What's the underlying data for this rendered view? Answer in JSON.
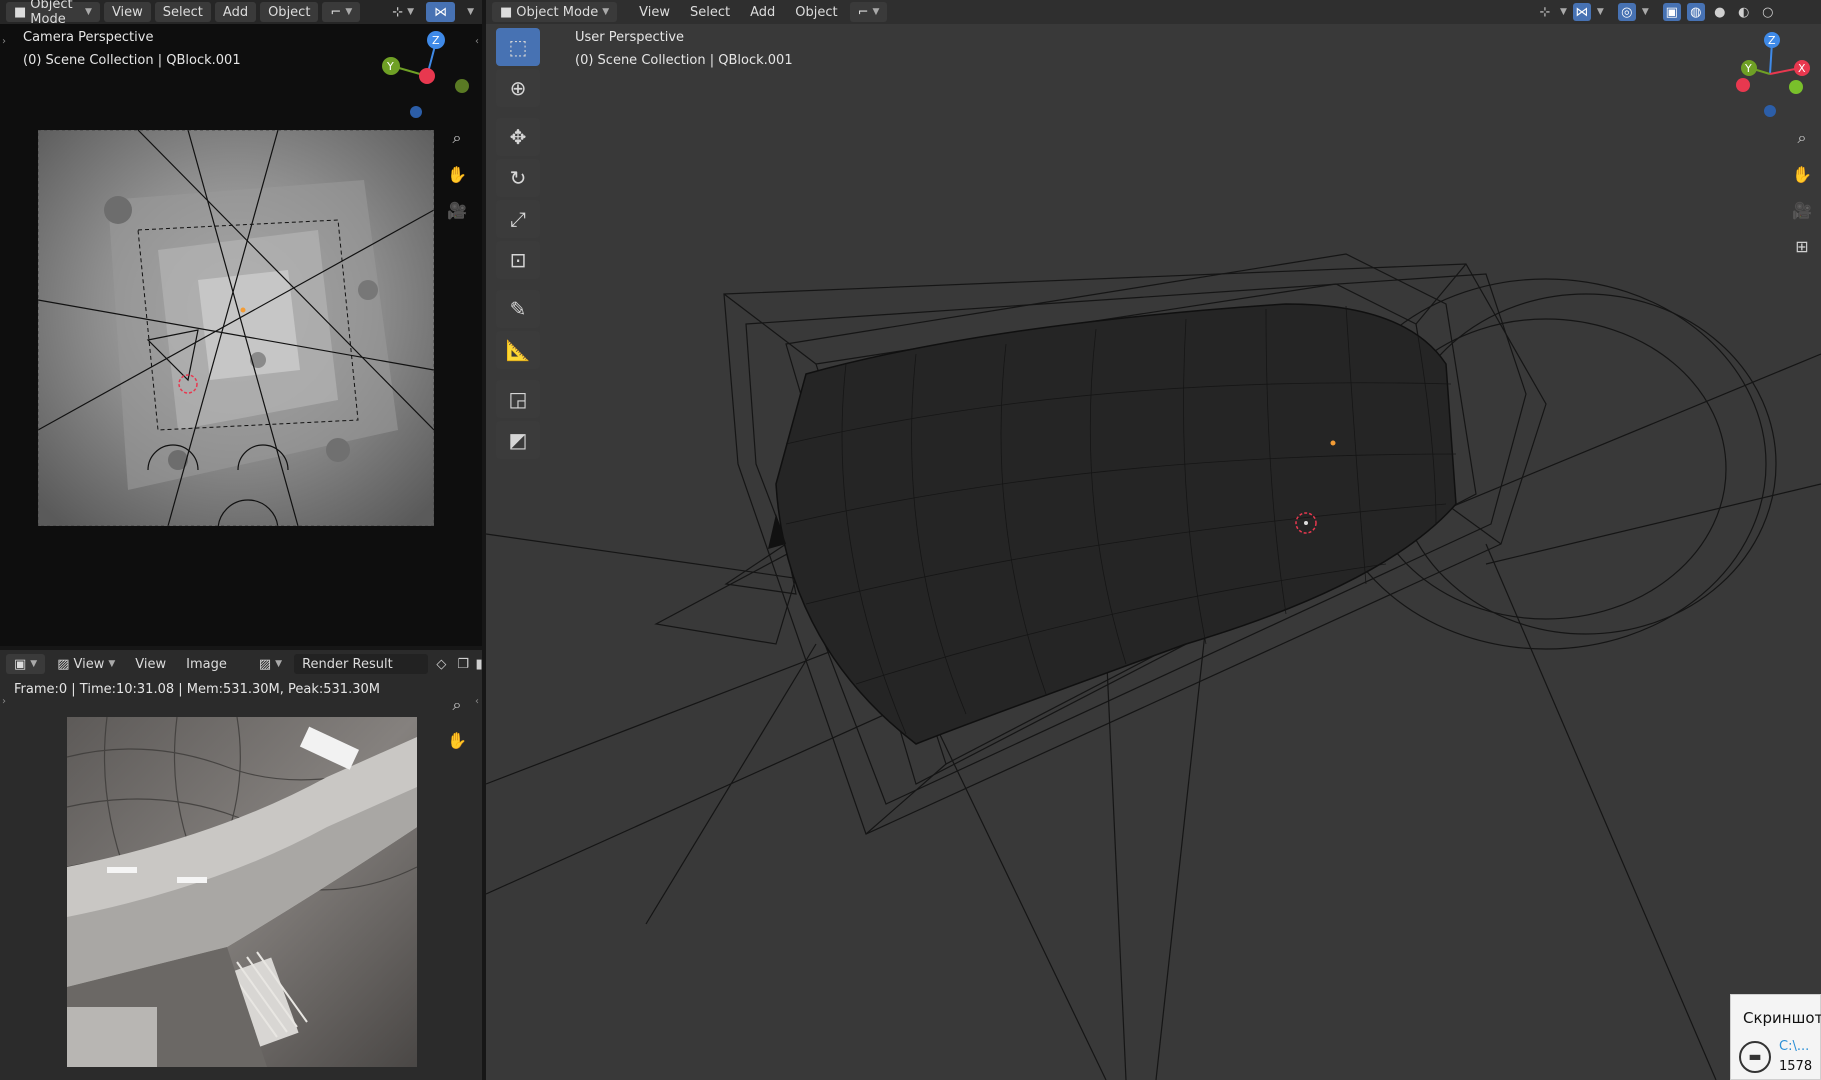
{
  "left_top": {
    "header": {
      "mode": "Object Mode",
      "menus": [
        "View",
        "Select",
        "Add",
        "Object"
      ]
    },
    "overlay": {
      "perspective": "Camera Perspective",
      "collection": "(0) Scene Collection | QBlock.001"
    }
  },
  "image_editor": {
    "header": {
      "view_dd": "View",
      "menus": [
        "View",
        "Image"
      ],
      "image_name": "Render Result"
    },
    "info": "Frame:0 | Time:10:31.08 | Mem:531.30M, Peak:531.30M"
  },
  "main": {
    "header": {
      "mode": "Object Mode",
      "menus": [
        "View",
        "Select",
        "Add",
        "Object"
      ]
    },
    "overlay": {
      "perspective": "User Perspective",
      "collection": "(0) Scene Collection | QBlock.001"
    }
  },
  "gizmo": {
    "z": "Z",
    "y": "Y",
    "x": "X"
  },
  "notification": {
    "title": "Скриншот",
    "path": "C:\\...",
    "number": "1578"
  },
  "icons": {
    "tools": [
      "select-box-icon",
      "cursor-icon",
      "move-icon",
      "rotate-icon",
      "scale-icon",
      "transform-icon",
      "annotate-icon",
      "measure-icon",
      "add-cube-icon",
      "add-plane-icon"
    ],
    "nav": [
      "zoom-icon",
      "hand-pan-icon",
      "camera-icon",
      "grid-ortho-icon"
    ]
  },
  "colors": {
    "accent": "#4772b3",
    "x_axis": "#e8384f",
    "y_axis": "#6fa025",
    "z_axis": "#3f8ae8",
    "origin": "#f39c35"
  }
}
